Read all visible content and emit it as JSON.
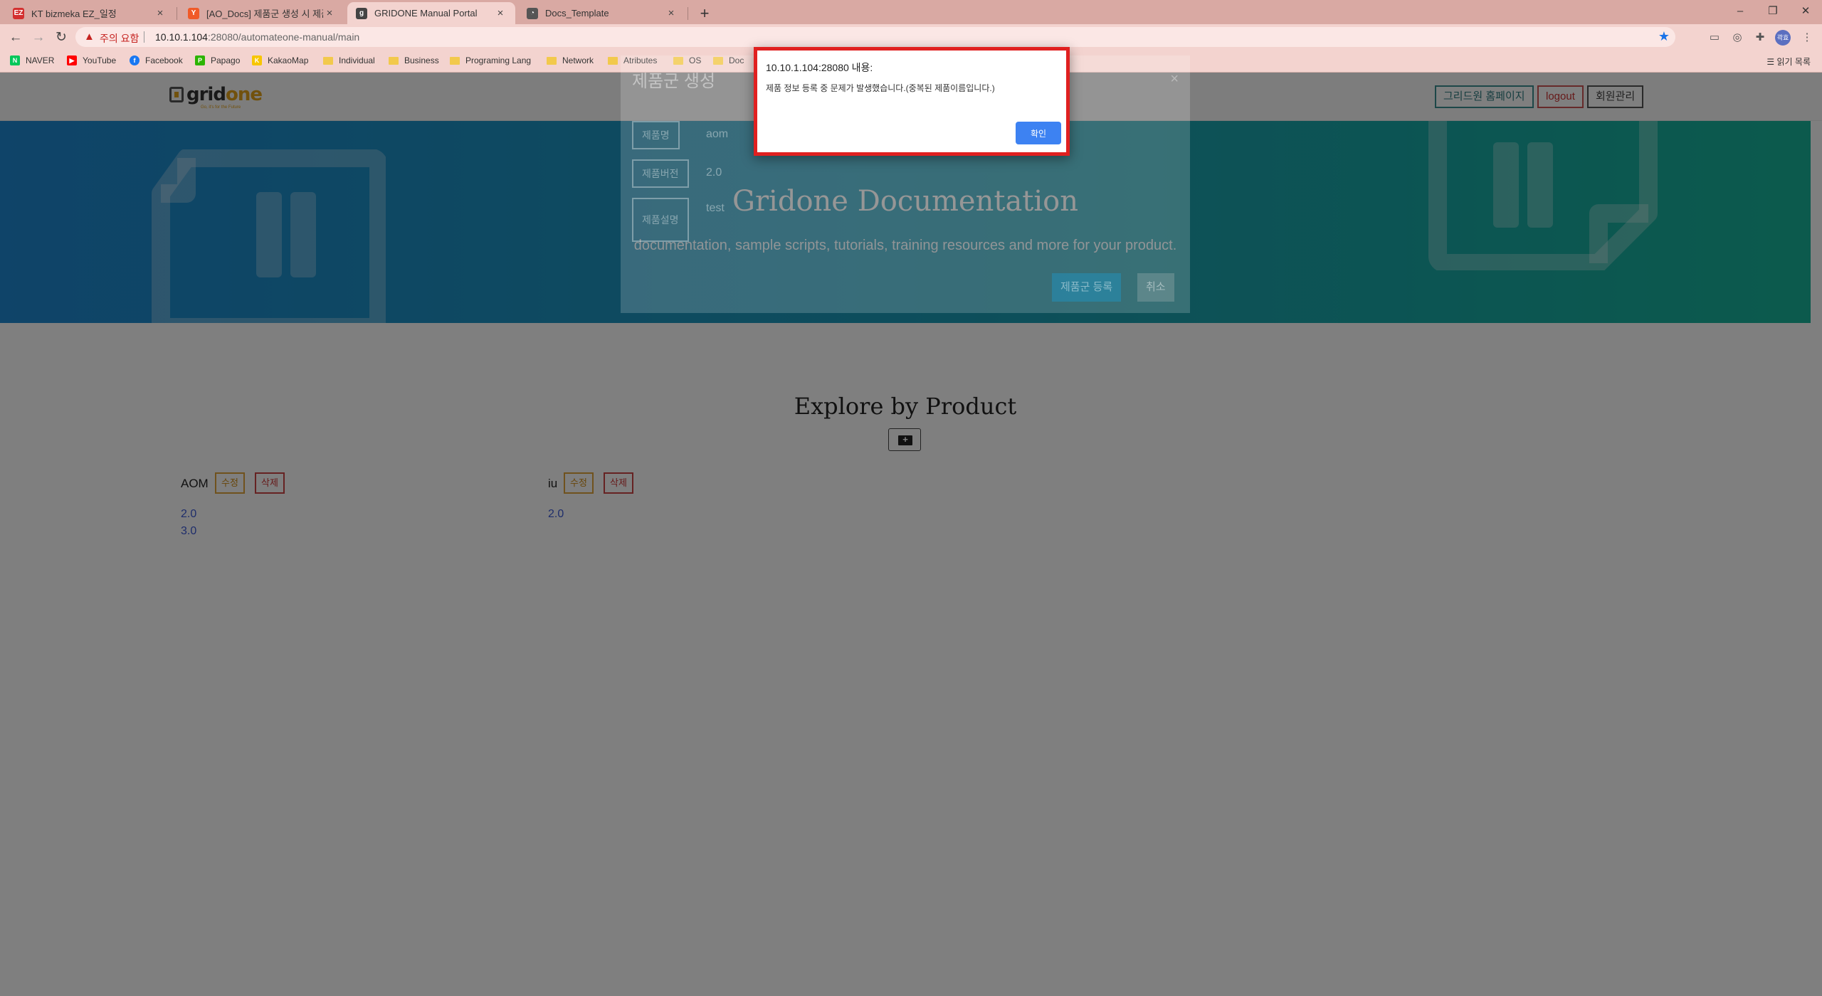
{
  "browser": {
    "tabs": [
      {
        "title": "KT bizmeka EZ_일정",
        "favicon_text": "EZ",
        "favicon_color": "#d32f2f"
      },
      {
        "title": "[AO_Docs] 제품군 생성 시 제품명…",
        "favicon_text": "Y",
        "favicon_color": "#f05a28"
      },
      {
        "title": "GRIDONE Manual Portal",
        "favicon_text": "g",
        "favicon_color": "#444444"
      },
      {
        "title": "Docs_Template",
        "favicon_text": "",
        "favicon_color": "#555555"
      }
    ],
    "address": {
      "warning": "주의 요함",
      "url_host": "10.10.1.104",
      "url_rest": ":28080/automateone-manual/main"
    },
    "profile_initials": "곽효",
    "bookmarks": [
      {
        "label": "NAVER",
        "kind": "icon",
        "color": "#03c75a",
        "glyph": "N"
      },
      {
        "label": "YouTube",
        "kind": "icon",
        "color": "#ff0000",
        "glyph": "▶"
      },
      {
        "label": "Facebook",
        "kind": "icon",
        "color": "#1877f2",
        "glyph": "f"
      },
      {
        "label": "Papago",
        "kind": "icon",
        "color": "#2db400",
        "glyph": "P"
      },
      {
        "label": "KakaoMap",
        "kind": "icon",
        "color": "#f7c600",
        "glyph": "K"
      },
      {
        "label": "Individual",
        "kind": "folder"
      },
      {
        "label": "Business",
        "kind": "folder"
      },
      {
        "label": "Programing Lang",
        "kind": "folder"
      },
      {
        "label": "Network",
        "kind": "folder"
      },
      {
        "label": "Atributes",
        "kind": "folder"
      },
      {
        "label": "OS",
        "kind": "folder"
      },
      {
        "label": "Doc",
        "kind": "folder"
      }
    ],
    "reading_list": "읽기 목록"
  },
  "header": {
    "logo_main": "grid",
    "logo_accent": "one",
    "logo_tag": "Go, it's for the Future",
    "buttons": [
      "그리드원 홈페이지",
      "logout",
      "회원관리"
    ]
  },
  "hero": {
    "title": "Gridone Documentation",
    "subtitle": "documentation, sample scripts, tutorials, training resources and more for your product."
  },
  "explore": {
    "title": "Explore by Product",
    "products": [
      {
        "name": "AOM",
        "edit": "수정",
        "delete": "삭제",
        "versions": [
          "2.0",
          "3.0"
        ]
      },
      {
        "name": "iu",
        "edit": "수정",
        "delete": "삭제",
        "versions": [
          "2.0"
        ]
      }
    ]
  },
  "modal": {
    "title": "제품군 생성",
    "rows": [
      {
        "label": "제품명",
        "value": "aom"
      },
      {
        "label": "제품버전",
        "value": "2.0"
      },
      {
        "label": "제품설명",
        "value": "test"
      }
    ],
    "submit": "제품군 등록",
    "cancel": "취소"
  },
  "alert": {
    "origin": "10.10.1.104:28080 내용:",
    "message": "제품 정보 등록 중 문제가 발생했습니다.(중복된 제품이름입니다.)",
    "ok": "확인",
    "highlight_color": "#e02020"
  }
}
